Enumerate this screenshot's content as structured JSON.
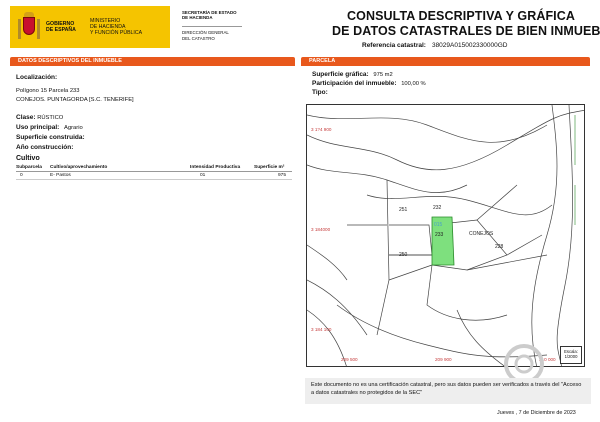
{
  "header": {
    "gov_line1": "GOBIERNO",
    "gov_line2": "DE ESPAÑA",
    "ministry_line1": "MINISTERIO",
    "ministry_line2": "DE HACIENDA",
    "ministry_line3": "Y FUNCIÓN PÚBLICA",
    "secretaria_line1": "SECRETARÍA DE ESTADO",
    "secretaria_line2": "DE HACIENDA",
    "direccion_line1": "DIRECCIÓN GENERAL",
    "direccion_line2": "DEL CATASTRO",
    "title_line1": "CONSULTA DESCRIPTIVA Y GRÁFICA",
    "title_line2": "DE DATOS CATASTRALES DE BIEN INMUEBLE",
    "ref_label": "Referencia catastral:",
    "ref_value": "38029A015002330000GD"
  },
  "left_panel": {
    "heading": "DATOS DESCRIPTIVOS DEL INMUEBLE",
    "localizacion_label": "Localización:",
    "localizacion_line1": "Polígono 15 Parcela 233",
    "localizacion_line2": "CONEJOS. PUNTAGORDA [S.C. TENERIFE]",
    "clase_label": "Clase:",
    "clase_value": "RÚSTICO",
    "uso_label": "Uso principal:",
    "uso_value": "Agrario",
    "superficie_label": "Superficie construida:",
    "anio_label": "Año construcción:",
    "cultivo_title": "Cultivo",
    "cultivo_headers": [
      "Subparcela",
      "Cultivo/aprovechamiento",
      "Intensidad Productiva",
      "Superficie m²"
    ],
    "cultivo_rows": [
      [
        "0",
        "E- Pastos",
        "01",
        "975"
      ]
    ]
  },
  "right_panel": {
    "heading": "PARCELA",
    "sup_grafica_label": "Superficie gráfica:",
    "sup_grafica_value": "975 m2",
    "participacion_label": "Participación del inmueble:",
    "participacion_value": "100,00 %",
    "tipo_label": "Tipo:"
  },
  "map": {
    "parcels": [
      "232",
      "251",
      "015",
      "233",
      "CONEJOS",
      "228",
      "250"
    ],
    "coords_left": [
      "3 1?4 900",
      "3 184000",
      "3 184 100"
    ],
    "coords_bottom": [
      "209 500",
      "209 900",
      "210 000"
    ],
    "scale_label": "Escala:",
    "scale_value": "1/2000",
    "highlight_color": "#7ee07e"
  },
  "footer": {
    "notice": "Este documento no es una certificación catastral, pero sus datos pueden ser verificados a través del \"Acceso a datos catastrales no protegidos de la SEC\"",
    "date": "Jueves , 7 de Diciembre de 2023",
    "watermark": "CELTRIP"
  },
  "colors": {
    "accent": "#e8581c",
    "gov_yellow": "#f5c400"
  }
}
